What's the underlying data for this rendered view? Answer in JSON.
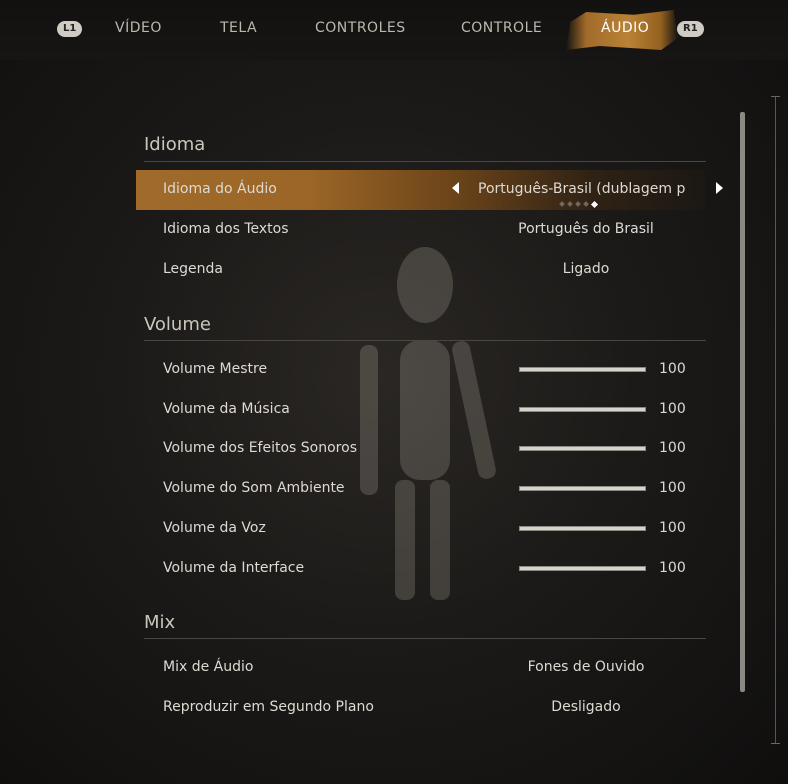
{
  "tabs": {
    "left_bumper": "L1",
    "right_bumper": "R1",
    "items": [
      "VÍDEO",
      "TELA",
      "CONTROLES",
      "CONTROLE",
      "ÁUDIO"
    ],
    "active": "ÁUDIO"
  },
  "sections": {
    "idioma": {
      "title": "Idioma",
      "rows": [
        {
          "label": "Idioma do Áudio",
          "value": "Português-Brasil (dublagem p"
        },
        {
          "label": "Idioma dos Textos",
          "value": "Português do Brasil"
        },
        {
          "label": "Legenda",
          "value": "Ligado"
        }
      ]
    },
    "volume": {
      "title": "Volume",
      "rows": [
        {
          "label": "Volume Mestre",
          "value": "100"
        },
        {
          "label": "Volume da Música",
          "value": "100"
        },
        {
          "label": "Volume dos Efeitos Sonoros",
          "value": "100"
        },
        {
          "label": "Volume do Som Ambiente",
          "value": "100"
        },
        {
          "label": "Volume da Voz",
          "value": "100"
        },
        {
          "label": "Volume da Interface",
          "value": "100"
        }
      ]
    },
    "mix": {
      "title": "Mix",
      "rows": [
        {
          "label": "Mix de Áudio",
          "value": "Fones de Ouvido"
        },
        {
          "label": "Reproduzir em Segundo Plano",
          "value": "Desligado"
        }
      ]
    }
  },
  "audio_language_selector": {
    "option_count": 5,
    "selected_index": 4
  },
  "colors": {
    "accent": "#a26a2a",
    "text": "#dedad3"
  }
}
